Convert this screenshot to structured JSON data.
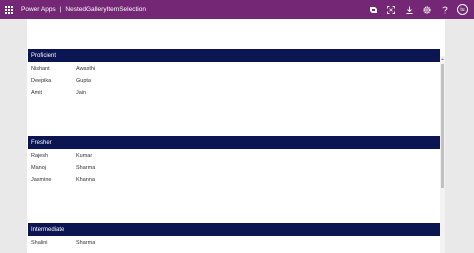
{
  "topbar": {
    "app_name": "Power Apps",
    "separator": "|",
    "app_title": "NestedGalleryItemSelection",
    "avatar_initials": "tu",
    "bg_color": "#742774"
  },
  "icons": [
    "waffle-icon",
    "copilot-icon",
    "fit-to-screen-icon",
    "download-icon",
    "settings-icon",
    "help-icon"
  ],
  "gallery": {
    "header_color": "#0a1551",
    "groups": [
      {
        "title": "Proficient",
        "rows": [
          {
            "first": "Nishant",
            "last": "Awasthi"
          },
          {
            "first": "Deepika",
            "last": "Gupta"
          },
          {
            "first": "Amit",
            "last": "Jain"
          }
        ]
      },
      {
        "title": "Fresher",
        "rows": [
          {
            "first": "Rajesh",
            "last": "Kumar"
          },
          {
            "first": "Manoj",
            "last": "Sharma"
          },
          {
            "first": "Jasmine",
            "last": "Khanna"
          }
        ]
      },
      {
        "title": "Intermediate",
        "rows": [
          {
            "first": "Shalini",
            "last": "Sharma"
          }
        ]
      }
    ]
  }
}
